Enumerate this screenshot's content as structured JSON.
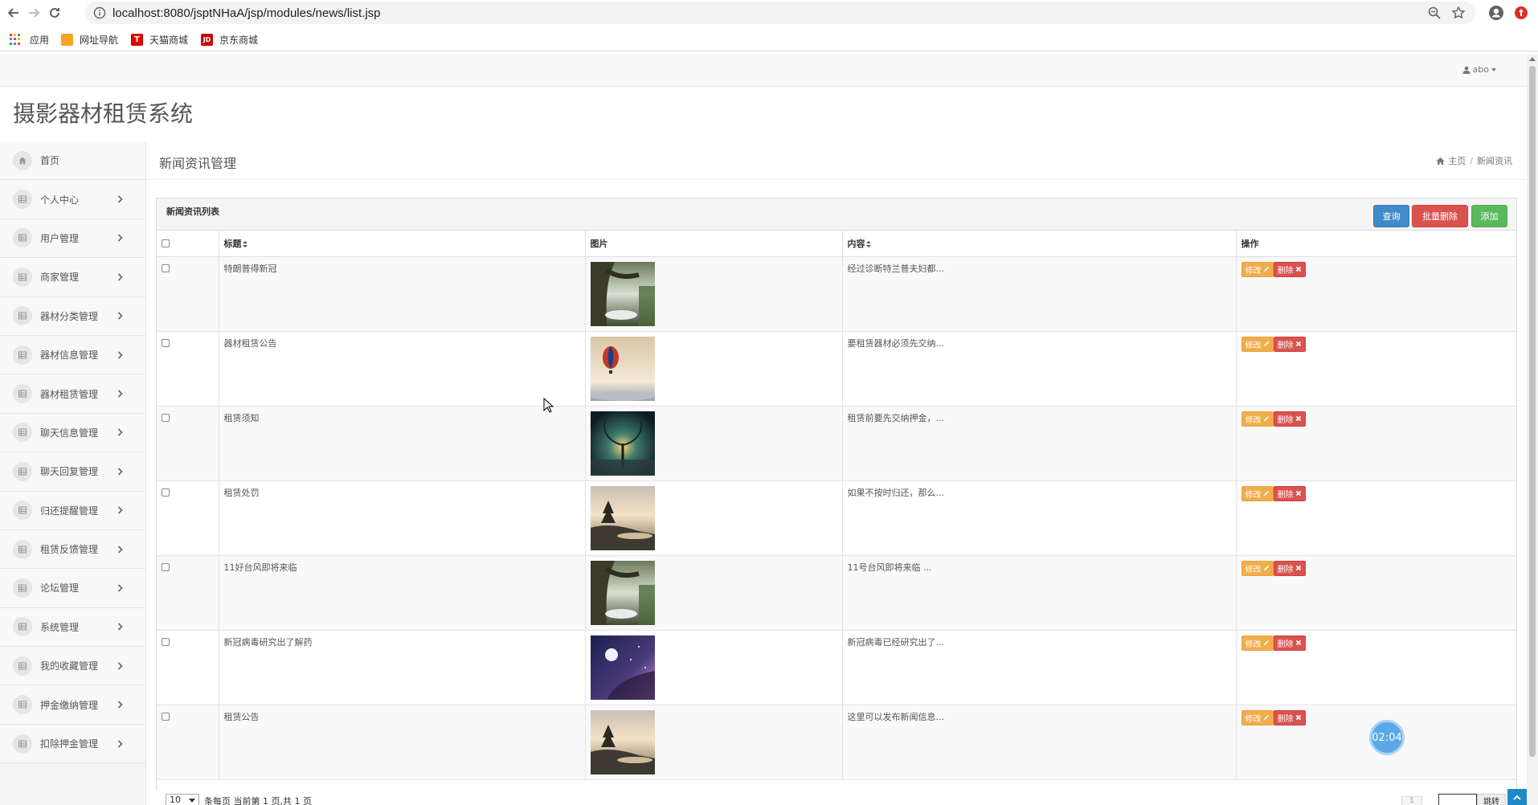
{
  "browser": {
    "url": "localhost:8080/jsptNHaA/jsp/modules/news/list.jsp",
    "bookmarks": [
      "应用",
      "网址导航",
      "天猫商城",
      "京东商城"
    ]
  },
  "app": {
    "title": "摄影器材租赁系统",
    "user": "abo"
  },
  "sidebar": {
    "items": [
      {
        "label": "首页",
        "icon": "home-icon",
        "arrow": false
      },
      {
        "label": "个人中心",
        "icon": "grid-icon",
        "arrow": true
      },
      {
        "label": "用户管理",
        "icon": "grid-icon",
        "arrow": true
      },
      {
        "label": "商家管理",
        "icon": "grid-icon",
        "arrow": true
      },
      {
        "label": "器材分类管理",
        "icon": "grid-icon",
        "arrow": true
      },
      {
        "label": "器材信息管理",
        "icon": "grid-icon",
        "arrow": true
      },
      {
        "label": "器材租赁管理",
        "icon": "grid-icon",
        "arrow": true
      },
      {
        "label": "聊天信息管理",
        "icon": "grid-icon",
        "arrow": true
      },
      {
        "label": "聊天回复管理",
        "icon": "grid-icon",
        "arrow": true
      },
      {
        "label": "归还提醒管理",
        "icon": "grid-icon",
        "arrow": true
      },
      {
        "label": "租赁反馈管理",
        "icon": "grid-icon",
        "arrow": true
      },
      {
        "label": "论坛管理",
        "icon": "grid-icon",
        "arrow": true
      },
      {
        "label": "系统管理",
        "icon": "grid-icon",
        "arrow": true
      },
      {
        "label": "我的收藏管理",
        "icon": "grid-icon",
        "arrow": true
      },
      {
        "label": "押金缴纳管理",
        "icon": "grid-icon",
        "arrow": true
      },
      {
        "label": "扣除押金管理",
        "icon": "grid-icon",
        "arrow": true
      }
    ]
  },
  "page": {
    "title": "新闻资讯管理",
    "breadcrumb": [
      "主页",
      "新闻资讯"
    ]
  },
  "panel": {
    "title": "新闻资讯列表",
    "buttons": {
      "query": "查询",
      "batch_delete": "批量删除",
      "add": "添加"
    },
    "columns": [
      "标题",
      "图片",
      "内容",
      "操作"
    ],
    "row_actions": {
      "edit": "修改",
      "delete": "删除"
    },
    "rows": [
      {
        "title": "特朗普得新冠",
        "image": "forest-tree",
        "content": "经过诊断特兰普夫妇都..."
      },
      {
        "title": "器材租赁公告",
        "image": "hot-air-balloon",
        "content": "要租赁器材必须先交纳..."
      },
      {
        "title": "租赁须知",
        "image": "glowing-tree-night",
        "content": "租赁前要先交纳押金，..."
      },
      {
        "title": "租赁处罚",
        "image": "lake-sunset-tree",
        "content": "如果不按时归还，那么..."
      },
      {
        "title": "11好台风即将来临",
        "image": "forest-tree",
        "content": "11号台风即将来临 ..."
      },
      {
        "title": "新冠病毒研究出了解药",
        "image": "moon-galaxy",
        "content": "新冠病毒已经研究出了..."
      },
      {
        "title": "租赁公告",
        "image": "lake-sunset-tree",
        "content": "这里可以发布新闻信息..."
      }
    ]
  },
  "pager": {
    "page_size": "10",
    "info": "条每页 当前第 1 页,共 1 页",
    "current_page": "1",
    "jump_label": "跳转"
  },
  "timer": "02:04",
  "colors": {
    "primary": "#428bca",
    "danger": "#d9534f",
    "success": "#5cb85c",
    "warning": "#f0ad4e"
  }
}
